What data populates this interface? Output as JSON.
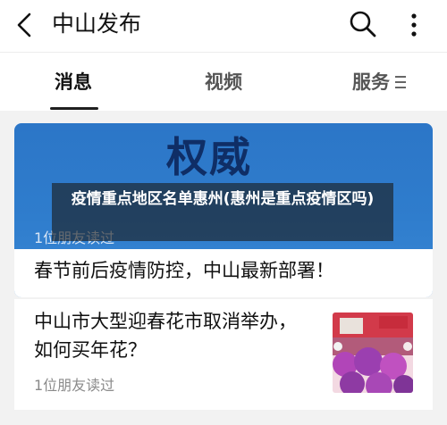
{
  "header": {
    "title": "中山发布",
    "back_icon": "chevron-left-icon",
    "search_icon": "search-icon",
    "more_icon": "more-vertical-icon"
  },
  "tabs": [
    {
      "label": "消息",
      "active": true
    },
    {
      "label": "视频",
      "active": false
    },
    {
      "label": "服务",
      "active": false
    }
  ],
  "feed": {
    "hero": {
      "image_text": "权威",
      "readers": "1位朋友读过",
      "headline": "春节前后疫情防控，中山最新部署！"
    },
    "overlay_caption": "疫情重点地区名单惠州(惠州是重点疫情区吗)",
    "item": {
      "title": "中山市大型迎春花市取消举办，如何买年花？",
      "readers": "1位朋友读过"
    }
  },
  "colors": {
    "hero_blue": "#2f7dcd",
    "hero_text": "#0f2e66",
    "background": "#f2f2f2"
  }
}
